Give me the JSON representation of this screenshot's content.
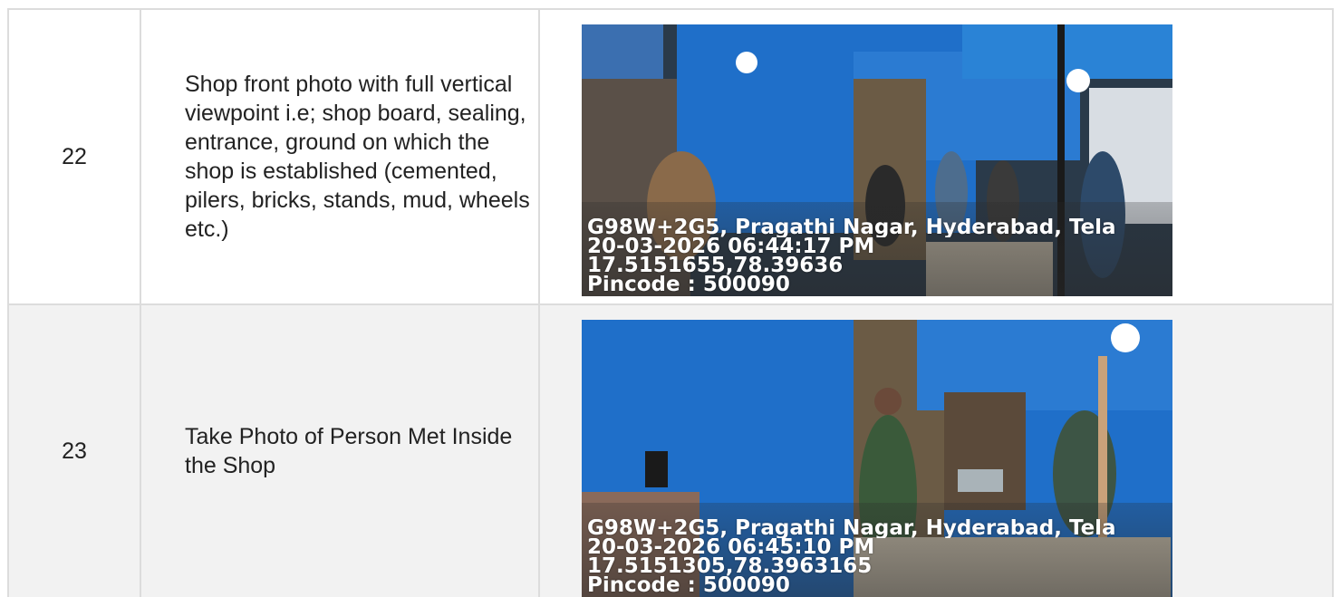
{
  "rows": [
    {
      "number": "22",
      "description": "Shop front photo with full vertical viewpoint i.e; shop board, sealing, entrance, ground on which the shop is established (cemented, pilers, bricks, stands, mud, wheels etc.)",
      "photo": {
        "address": "G98W+2G5, Pragathi Nagar, Hyderabad, Tela",
        "datetime": "20-03-2026 06:44:17 PM",
        "coords": "17.5151655,78.39636",
        "pincode": "Pincode : 500090"
      }
    },
    {
      "number": "23",
      "description": "Take Photo of Person Met Inside the Shop",
      "photo": {
        "address": "G98W+2G5, Pragathi Nagar, Hyderabad, Tela",
        "datetime": "20-03-2026 06:45:10 PM",
        "coords": "17.5151305,78.3963165",
        "pincode": "Pincode : 500090"
      }
    }
  ],
  "colors": {
    "tarp": "#1f6fc9",
    "border": "#dcdcdc",
    "alt_row": "#f2f2f2"
  }
}
